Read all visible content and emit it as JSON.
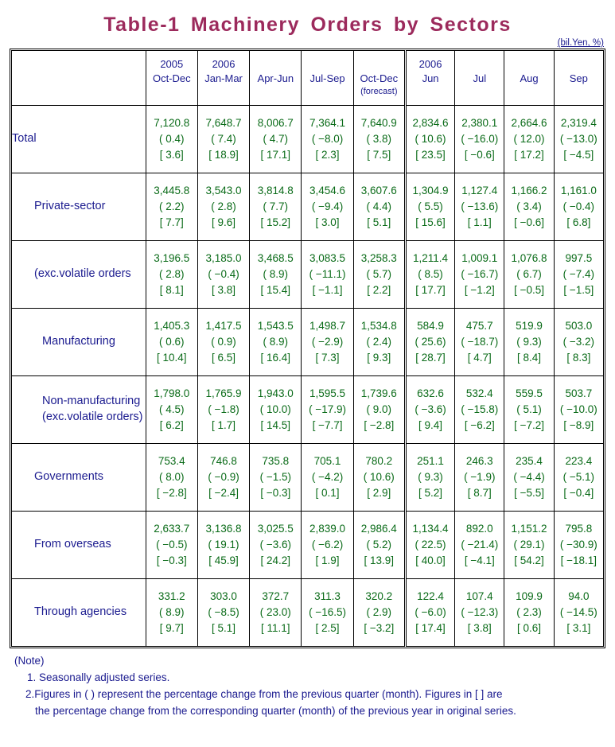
{
  "title": "Table-1  Machinery  Orders  by  Sectors",
  "unit_note": "(bil.Yen, %)",
  "header": {
    "corner_label": "",
    "columns": [
      {
        "year": "2005",
        "period": "Oct-Dec",
        "extra": ""
      },
      {
        "year": "2006",
        "period": "Jan-Mar",
        "extra": ""
      },
      {
        "year": "",
        "period": "Apr-Jun",
        "extra": ""
      },
      {
        "year": "",
        "period": "Jul-Sep",
        "extra": ""
      },
      {
        "year": "",
        "period": "Oct-Dec",
        "extra": "(forecast)"
      },
      {
        "year": "2006",
        "period": "Jun",
        "extra": ""
      },
      {
        "year": "",
        "period": "Jul",
        "extra": ""
      },
      {
        "year": "",
        "period": "Aug",
        "extra": ""
      },
      {
        "year": "",
        "period": "Sep",
        "extra": ""
      }
    ]
  },
  "rows": [
    {
      "label": "Total",
      "label2": "",
      "values": [
        "7,120.8",
        "7,648.7",
        "8,006.7",
        "7,364.1",
        "7,640.9",
        "2,834.6",
        "2,380.1",
        "2,664.6",
        "2,319.4"
      ],
      "paren": [
        "( 0.4)",
        "( 7.4)",
        "( 4.7)",
        "( −8.0)",
        "( 3.8)",
        "( 10.6)",
        "( −16.0)",
        "( 12.0)",
        "( −13.0)"
      ],
      "bracket": [
        "[ 3.6]",
        "[ 18.9]",
        "[ 17.1]",
        "[ 2.3]",
        "[ 7.5]",
        "[ 23.5]",
        "[ −0.6]",
        "[ 17.2]",
        "[ −4.5]"
      ]
    },
    {
      "label": "Private-sector",
      "label2": "",
      "values": [
        "3,445.8",
        "3,543.0",
        "3,814.8",
        "3,454.6",
        "3,607.6",
        "1,304.9",
        "1,127.4",
        "1,166.2",
        "1,161.0"
      ],
      "paren": [
        "( 2.2)",
        "( 2.8)",
        "( 7.7)",
        "( −9.4)",
        "( 4.4)",
        "( 5.5)",
        "( −13.6)",
        "( 3.4)",
        "( −0.4)"
      ],
      "bracket": [
        "[ 7.7]",
        "[ 9.6]",
        "[ 15.2]",
        "[ 3.0]",
        "[ 5.1]",
        "[ 15.6]",
        "[ 1.1]",
        "[ −0.6]",
        "[ 6.8]"
      ]
    },
    {
      "label": "(exc.volatile orders",
      "label2": "",
      "values": [
        "3,196.5",
        "3,185.0",
        "3,468.5",
        "3,083.5",
        "3,258.3",
        "1,211.4",
        "1,009.1",
        "1,076.8",
        "997.5"
      ],
      "paren": [
        "( 2.8)",
        "( −0.4)",
        "( 8.9)",
        "( −11.1)",
        "( 5.7)",
        "( 8.5)",
        "( −16.7)",
        "( 6.7)",
        "( −7.4)"
      ],
      "bracket": [
        "[ 8.1]",
        "[ 3.8]",
        "[ 15.4]",
        "[ −1.1]",
        "[ 2.2]",
        "[ 17.7]",
        "[ −1.2]",
        "[ −0.5]",
        "[ −1.5]"
      ]
    },
    {
      "label": "Manufacturing",
      "label2": "",
      "values": [
        "1,405.3",
        "1,417.5",
        "1,543.5",
        "1,498.7",
        "1,534.8",
        "584.9",
        "475.7",
        "519.9",
        "503.0"
      ],
      "paren": [
        "( 0.6)",
        "( 0.9)",
        "( 8.9)",
        "( −2.9)",
        "( 2.4)",
        "( 25.6)",
        "( −18.7)",
        "( 9.3)",
        "( −3.2)"
      ],
      "bracket": [
        "[ 10.4]",
        "[ 6.5]",
        "[ 16.4]",
        "[ 7.3]",
        "[ 9.3]",
        "[ 28.7]",
        "[ 4.7]",
        "[ 8.4]",
        "[ 8.3]"
      ]
    },
    {
      "label": "Non-manufacturing",
      "label2": "(exc.volatile orders)",
      "values": [
        "1,798.0",
        "1,765.9",
        "1,943.0",
        "1,595.5",
        "1,739.6",
        "632.6",
        "532.4",
        "559.5",
        "503.7"
      ],
      "paren": [
        "( 4.5)",
        "( −1.8)",
        "( 10.0)",
        "( −17.9)",
        "( 9.0)",
        "( −3.6)",
        "( −15.8)",
        "( 5.1)",
        "( −10.0)"
      ],
      "bracket": [
        "[ 6.2]",
        "[ 1.7]",
        "[ 14.5]",
        "[ −7.7]",
        "[ −2.8]",
        "[ 9.4]",
        "[ −6.2]",
        "[ −7.2]",
        "[ −8.9]"
      ]
    },
    {
      "label": "Governments",
      "label2": "",
      "values": [
        "753.4",
        "746.8",
        "735.8",
        "705.1",
        "780.2",
        "251.1",
        "246.3",
        "235.4",
        "223.4"
      ],
      "paren": [
        "( 8.0)",
        "( −0.9)",
        "( −1.5)",
        "( −4.2)",
        "( 10.6)",
        "( 9.3)",
        "( −1.9)",
        "( −4.4)",
        "( −5.1)"
      ],
      "bracket": [
        "[ −2.8]",
        "[ −2.4]",
        "[ −0.3]",
        "[ 0.1]",
        "[ 2.9]",
        "[ 5.2]",
        "[ 8.7]",
        "[ −5.5]",
        "[ −0.4]"
      ]
    },
    {
      "label": "From overseas",
      "label2": "",
      "values": [
        "2,633.7",
        "3,136.8",
        "3,025.5",
        "2,839.0",
        "2,986.4",
        "1,134.4",
        "892.0",
        "1,151.2",
        "795.8"
      ],
      "paren": [
        "( −0.5)",
        "( 19.1)",
        "( −3.6)",
        "( −6.2)",
        "( 5.2)",
        "( 22.5)",
        "( −21.4)",
        "( 29.1)",
        "( −30.9)"
      ],
      "bracket": [
        "[ −0.3]",
        "[ 45.9]",
        "[ 24.2]",
        "[ 1.9]",
        "[ 13.9]",
        "[ 40.0]",
        "[ −4.1]",
        "[ 54.2]",
        "[ −18.1]"
      ]
    },
    {
      "label": "Through agencies",
      "label2": "",
      "values": [
        "331.2",
        "303.0",
        "372.7",
        "311.3",
        "320.2",
        "122.4",
        "107.4",
        "109.9",
        "94.0"
      ],
      "paren": [
        "( 8.9)",
        "( −8.5)",
        "( 23.0)",
        "( −16.5)",
        "( 2.9)",
        "( −6.0)",
        "( −12.3)",
        "( 2.3)",
        "( −14.5)"
      ],
      "bracket": [
        "[ 9.7]",
        "[ 5.1]",
        "[ 11.1]",
        "[ 2.5]",
        "[ −3.2]",
        "[ 17.4]",
        "[ 3.8]",
        "[ 0.6]",
        "[ 3.1]"
      ]
    }
  ],
  "notes": {
    "heading": "(Note)",
    "item1": "1. Seasonally adjusted series.",
    "item2_line1": "2.Figures in ( ) represent the percentage change from the previous quarter (month). Figures in [ ] are",
    "item2_line2": "the percentage change from the corresponding quarter (month) of the previous year in original series."
  },
  "colors": {
    "title": "#9c2a5c",
    "label_text": "#1b1b8f",
    "data_text": "#0a6b18",
    "border": "#000000",
    "background": "#ffffff"
  }
}
